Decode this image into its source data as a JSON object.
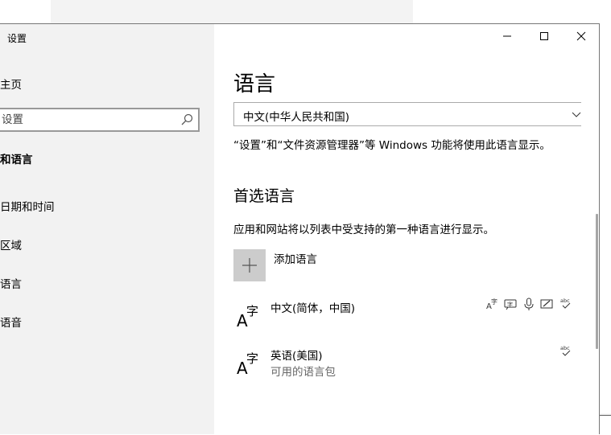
{
  "window": {
    "title": "设置"
  },
  "sidebar": {
    "home": "主页",
    "search_placeholder": "设置",
    "items": [
      "和语言",
      "日期和时间",
      "区域",
      "语言",
      "语音"
    ]
  },
  "main": {
    "title": "语言",
    "display_language": {
      "selected": "中文(中华人民共和国)",
      "description": "“设置”和“文件资源管理器”等 Windows 功能将使用此语言显示。"
    },
    "preferred": {
      "title": "首选语言",
      "description": "应用和网站将以列表中受支持的第一种语言进行显示。",
      "add_label": "添加语言",
      "languages": [
        {
          "name": "中文(简体，中国)",
          "sub": "",
          "features": [
            "display-language-icon",
            "text-to-speech-icon",
            "microphone-icon",
            "handwriting-icon",
            "spellcheck-icon"
          ]
        },
        {
          "name": "英语(美国)",
          "sub": "可用的语言包",
          "features": [
            "spellcheck-icon"
          ]
        }
      ]
    }
  },
  "colors": {
    "sidebar_bg": "#f2f2f2",
    "add_button_bg": "#cccccc",
    "secondary_text": "#666666"
  }
}
